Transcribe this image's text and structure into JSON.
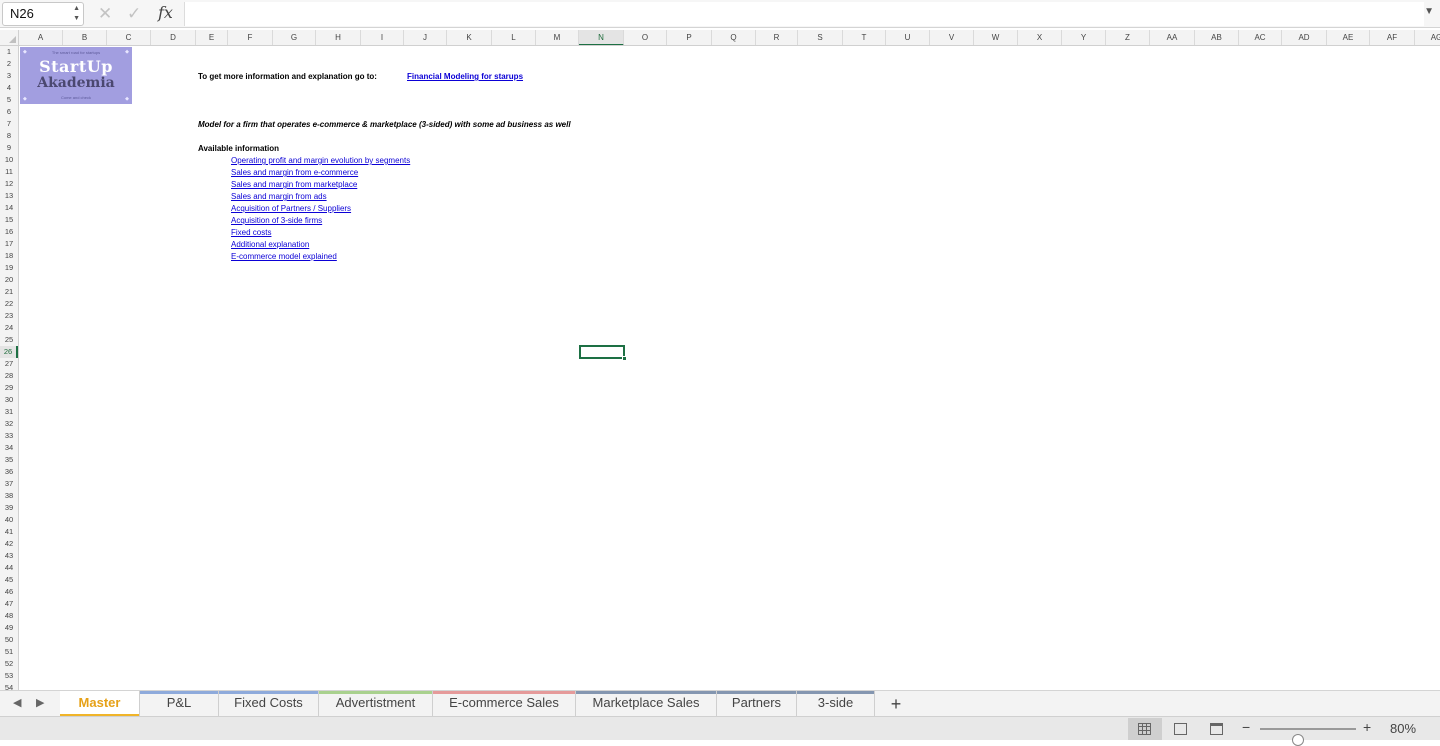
{
  "formula_bar": {
    "name_box": "N26",
    "cancel_icon": "x-icon",
    "enter_icon": "check-icon",
    "fx_label": "fx",
    "formula": ""
  },
  "columns": [
    "A",
    "B",
    "C",
    "D",
    "E",
    "F",
    "G",
    "H",
    "I",
    "J",
    "K",
    "L",
    "M",
    "N",
    "O",
    "P",
    "Q",
    "R",
    "S",
    "T",
    "U",
    "V",
    "W",
    "X",
    "Y",
    "Z",
    "AA",
    "AB",
    "AC",
    "AD",
    "AE",
    "AF",
    "AG"
  ],
  "active_column": "N",
  "rows": [
    "1",
    "2",
    "3",
    "4",
    "5",
    "6",
    "7",
    "8",
    "9",
    "10",
    "11",
    "12",
    "13",
    "14",
    "15",
    "16",
    "17",
    "18",
    "19",
    "20",
    "21",
    "22",
    "23",
    "24",
    "25",
    "26",
    "27",
    "28",
    "29",
    "30",
    "31",
    "32",
    "33",
    "34",
    "35",
    "36",
    "37",
    "38",
    "39",
    "40",
    "41",
    "42",
    "43",
    "44",
    "45",
    "46",
    "47",
    "48",
    "49",
    "50",
    "51",
    "52",
    "53",
    "54"
  ],
  "active_row": "26",
  "logo": {
    "tagline": "The smart road for startups",
    "line1": "StartUp",
    "line2": "Akademia",
    "footer": "Come and check"
  },
  "sheet": {
    "info_label": "To get more information and explanation go to:",
    "info_link": "Financial Modeling for starups",
    "model_description": "Model for a firm that operates e-commerce & marketplace (3-sided) with some ad business as well",
    "available_heading": "Available information",
    "links": [
      "Operating profit and margin evolution by segments",
      "Sales and margin from e-commerce",
      "Sales and margin from marketplace",
      "Sales and margin from ads",
      "Acquisition of Partners / Suppliers",
      "Acquisition of 3-side firms",
      "Fixed costs",
      "Additional explanation",
      "E-commerce model explained"
    ]
  },
  "tabs": [
    {
      "label": "Master",
      "color": "#f0b429",
      "active": true
    },
    {
      "label": "P&L",
      "color": "#8eaadb"
    },
    {
      "label": "Fixed Costs",
      "color": "#8eaadb"
    },
    {
      "label": "Advertistment",
      "color": "#a9d18e"
    },
    {
      "label": "E-commerce Sales",
      "color": "#e59a9a"
    },
    {
      "label": "Marketplace Sales",
      "color": "#8496b0"
    },
    {
      "label": "Partners",
      "color": "#8496b0"
    },
    {
      "label": "3-side",
      "color": "#8496b0"
    }
  ],
  "add_sheet_label": "+",
  "status": {
    "zoom_label": "80%",
    "zoom_fraction": 0.4,
    "views": [
      "normal-view-icon",
      "page-layout-icon",
      "page-break-icon"
    ],
    "zoom_minus": "−",
    "zoom_plus": "+"
  }
}
